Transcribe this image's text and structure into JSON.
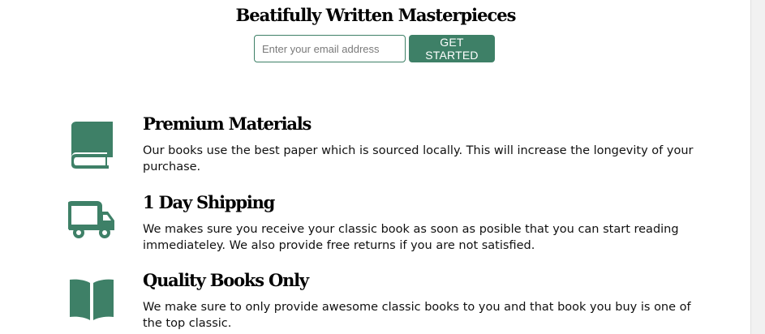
{
  "hero": {
    "title": "Beatifully Written Masterpieces",
    "email_placeholder": "Enter your email address",
    "cta_label": "GET STARTED"
  },
  "colors": {
    "accent": "#3e8067",
    "text": "#000000",
    "background": "#ffffff"
  },
  "features": [
    {
      "icon": "book-icon",
      "title": "Premium Materials",
      "text": "Our books use the best paper which is sourced locally. This will increase the longevity of your purchase."
    },
    {
      "icon": "truck-icon",
      "title": "1 Day Shipping",
      "text": "We makes sure you receive your classic book as soon as posible that you can start reading immediateley. We also provide free returns if you are not satisfied."
    },
    {
      "icon": "open-book-icon",
      "title": "Quality Books Only",
      "text": "We make sure to only provide awesome classic books to you and that book you buy is one of the top classic."
    }
  ]
}
